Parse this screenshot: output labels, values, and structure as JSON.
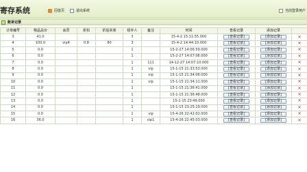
{
  "header": {
    "title": "寄存系统",
    "home_link": "回首页",
    "logout_link": "退出系统",
    "user_link": "当前登录用户"
  },
  "section": {
    "title": "账单记录"
  },
  "table": {
    "columns": [
      "订单编号",
      "物品总价",
      "会员",
      "折扣",
      "折后实收",
      "经手人",
      "备注",
      "时间",
      "查看记录",
      "添加记录"
    ],
    "view_label": "[查看记录]",
    "add_label": "[添加记录]",
    "delete_glyph": "✕",
    "rows": [
      {
        "id": "3",
        "total": "41.0",
        "member": "",
        "discount": "",
        "paid": "",
        "handler": "3",
        "note": "",
        "time": "15-4-2 15:11:55.000"
      },
      {
        "id": "4",
        "total": "100.0",
        "member": "vip4",
        "discount": "0.8",
        "paid": "80",
        "handler": "3",
        "note": "",
        "time": "15-4-2 14:44:10.000"
      },
      {
        "id": "5",
        "total": "0.0",
        "member": "",
        "discount": "",
        "paid": "",
        "handler": "1",
        "note": "",
        "time": "15-2-27 14:06:59.000"
      },
      {
        "id": "6",
        "total": "0.0",
        "member": "",
        "discount": "",
        "paid": "",
        "handler": "1",
        "note": "",
        "time": "15-2-27 14:07:06.000"
      },
      {
        "id": "7",
        "total": "0.0",
        "member": "",
        "discount": "",
        "paid": "",
        "handler": "1",
        "note": "111",
        "time": "14-12-27 14:07:10.000"
      },
      {
        "id": "8",
        "total": "0.0",
        "member": "",
        "discount": "",
        "paid": "",
        "handler": "1",
        "note": "vip",
        "time": "15-1-15 21:33:53.000"
      },
      {
        "id": "9",
        "total": "0.0",
        "member": "",
        "discount": "",
        "paid": "",
        "handler": "1",
        "note": "vip",
        "time": "15-1-15 21:34:06.000"
      },
      {
        "id": "10",
        "total": "0.0",
        "member": "",
        "discount": "",
        "paid": "",
        "handler": "1",
        "note": "vip",
        "time": "15-1-15 21:34:11.000"
      },
      {
        "id": "11",
        "total": "0.0",
        "member": "",
        "discount": "",
        "paid": "",
        "handler": "1",
        "note": "",
        "time": "15-1-15 21:36:41.000"
      },
      {
        "id": "12",
        "total": "0.0",
        "member": "",
        "discount": "",
        "paid": "",
        "handler": "1",
        "note": "",
        "time": "15-1-15 21:36:48.000"
      },
      {
        "id": "13",
        "total": "0.0",
        "member": "",
        "discount": "",
        "paid": "",
        "handler": "1",
        "note": "",
        "time": "15-1-15 23:49.000"
      },
      {
        "id": "14",
        "total": "0.0",
        "member": "",
        "discount": "",
        "paid": "",
        "handler": "1",
        "note": "",
        "time": "15-1-15 23:25:19.000"
      },
      {
        "id": "15",
        "total": "0.0",
        "member": "",
        "discount": "",
        "paid": "",
        "handler": "1",
        "note": "vip",
        "time": "15-4-26 22:42:02.000"
      },
      {
        "id": "16",
        "total": "36.0",
        "member": "",
        "discount": "",
        "paid": "",
        "handler": "1",
        "note": "vip1",
        "time": "15-4-26 22:45:03.000"
      }
    ]
  },
  "colors": {
    "accent": "#e3eec6",
    "border": "#c3d39a",
    "delete": "#d9261c"
  }
}
